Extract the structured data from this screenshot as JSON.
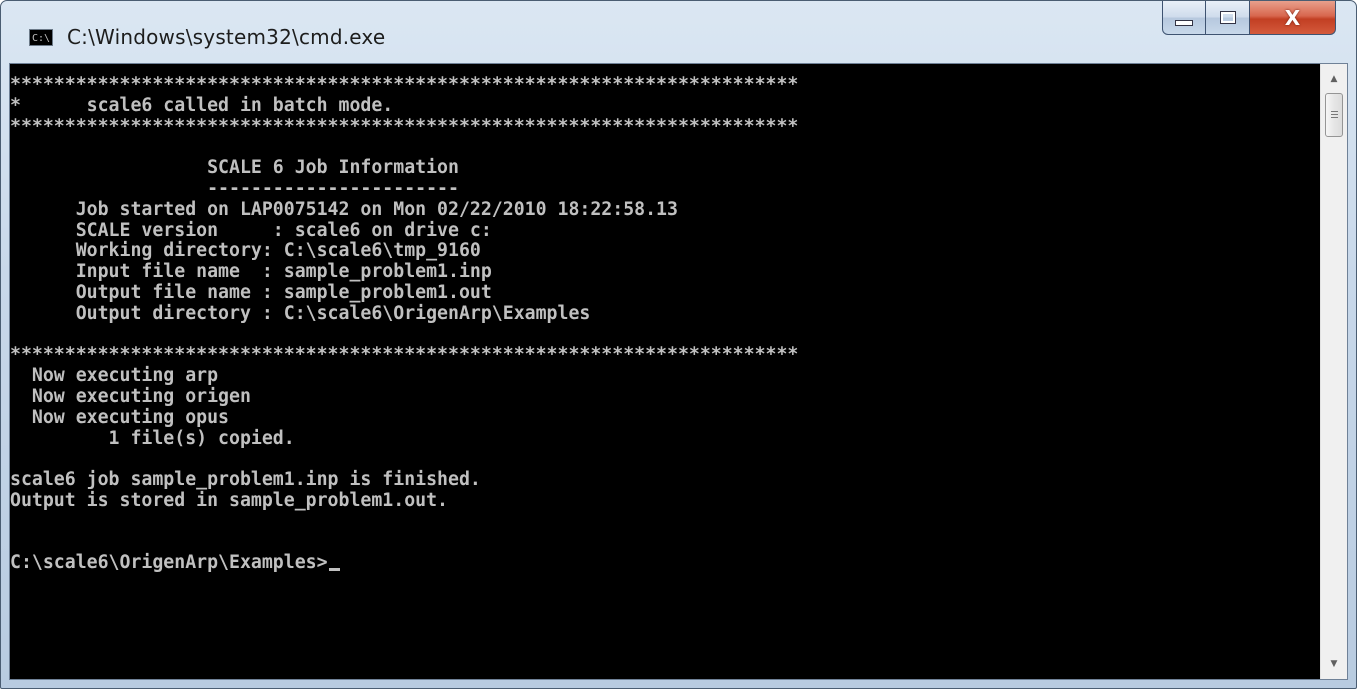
{
  "window": {
    "title": "C:\\Windows\\system32\\cmd.exe",
    "icon_label": "C:\\",
    "icon_name": "cmd-console-icon",
    "buttons": {
      "minimize_icon": "minimize-icon",
      "maximize_icon": "maximize-icon",
      "close_icon": "close-icon",
      "close_glyph": "X"
    }
  },
  "console": {
    "lines": [
      "************************************************************************",
      "*      scale6 called in batch mode.",
      "************************************************************************",
      "",
      "                  SCALE 6 Job Information",
      "                  -----------------------",
      "      Job started on LAP0075142 on Mon 02/22/2010 18:22:58.13",
      "      SCALE version     : scale6 on drive c:",
      "      Working directory: C:\\scale6\\tmp_9160",
      "      Input file name  : sample_problem1.inp",
      "      Output file name : sample_problem1.out",
      "      Output directory : C:\\scale6\\OrigenArp\\Examples",
      "",
      "************************************************************************",
      "  Now executing arp",
      "  Now executing origen",
      "  Now executing opus",
      "         1 file(s) copied.",
      "",
      "scale6 job sample_problem1.inp is finished.",
      "Output is stored in sample_problem1.out.",
      "",
      ""
    ],
    "prompt": "C:\\scale6\\OrigenArp\\Examples>",
    "text_color": "#c0c0c0",
    "background_color": "#000000"
  },
  "scrollbar": {
    "up_arrow": "▲",
    "down_arrow": "▼",
    "up_icon": "scroll-up-arrow-icon",
    "down_icon": "scroll-down-arrow-icon"
  },
  "colors": {
    "close_button": "#c94a2f",
    "title_bar": "#c8d8ea"
  }
}
